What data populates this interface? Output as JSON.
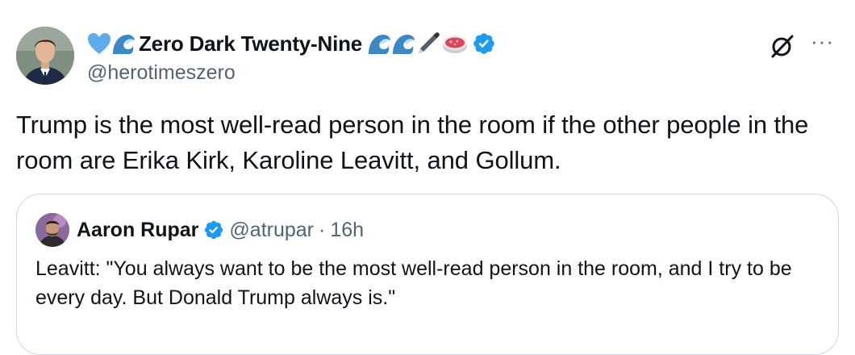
{
  "post": {
    "author": {
      "display_name": "Zero Dark Twenty-Nine",
      "handle": "@herotimeszero",
      "verified": true,
      "name_emojis_before": [
        "blue-heart",
        "water-wave"
      ],
      "name_emojis_after": [
        "water-wave",
        "water-wave",
        "fountain-pen",
        "petri-dish",
        "verified-badge"
      ]
    },
    "text": "Trump is the most well-read person in the room if the other people in the room are Erika Kirk, Karoline Leavitt, and Gollum.",
    "actions": {
      "grok": "grok-icon",
      "more": "···"
    }
  },
  "quoted_post": {
    "author": {
      "display_name": "Aaron Rupar",
      "handle": "@atrupar",
      "verified": true
    },
    "separator": "·",
    "time": "16h",
    "text": "Leavitt: \"You always want to be the most well-read person in the room, and I try to be every day. But Donald Trump always is.\""
  },
  "colors": {
    "text": "#0f1419",
    "secondary": "#536471",
    "verified": "#1d9bf0",
    "border": "#cfd9de",
    "heart": "#5dadec",
    "wave": "#3b88c3"
  }
}
